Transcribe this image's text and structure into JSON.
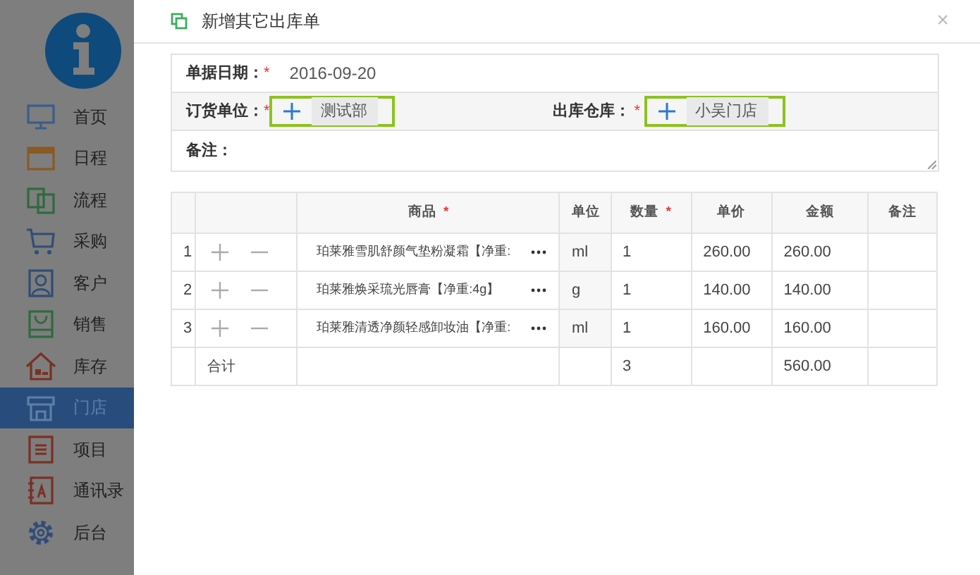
{
  "sidebar": {
    "items": [
      {
        "label": "首页",
        "selected": false
      },
      {
        "label": "日程",
        "selected": false
      },
      {
        "label": "流程",
        "selected": false
      },
      {
        "label": "采购",
        "selected": false
      },
      {
        "label": "客户",
        "selected": false
      },
      {
        "label": "销售",
        "selected": false
      },
      {
        "label": "库存",
        "selected": false
      },
      {
        "label": "门店",
        "selected": true
      },
      {
        "label": "项目",
        "selected": false
      },
      {
        "label": "通讯录",
        "selected": false
      },
      {
        "label": "后台",
        "selected": false
      }
    ]
  },
  "dialog": {
    "title": "新增其它出库单",
    "close": "×",
    "form": {
      "date": {
        "label": "单据日期：",
        "mark": "*",
        "value": "2016-09-20"
      },
      "customer": {
        "label": "订货单位：",
        "mark": "*",
        "value": "测试部",
        "highlighted": true
      },
      "warehouse": {
        "label": "出库仓库：",
        "mark": "*",
        "value": "小吴门店",
        "highlighted": true
      },
      "note": {
        "label": "备注："
      }
    },
    "table": {
      "columns": [
        {
          "label": "商品",
          "mark": "*"
        },
        {
          "label": "单位"
        },
        {
          "label": "数量",
          "mark": "*"
        },
        {
          "label": "单价"
        },
        {
          "label": "金额"
        },
        {
          "label": "备注"
        }
      ],
      "rows": [
        {
          "index": "1",
          "product": "珀莱雅雪肌舒颜气垫粉凝霜【净重:",
          "unit": "ml",
          "qty": "1",
          "price": "260.00",
          "amount": "260.00"
        },
        {
          "index": "2",
          "product": "珀莱雅焕采琉光唇膏【净重:4g】",
          "unit": "g",
          "qty": "1",
          "price": "140.00",
          "amount": "140.00"
        },
        {
          "index": "3",
          "product": "珀莱雅清透净颜轻感卸妆油【净重:",
          "unit": "ml",
          "qty": "1",
          "price": "160.00",
          "amount": "160.00"
        }
      ],
      "total": {
        "label": "合计",
        "qty": "3",
        "amount": "560.00"
      }
    }
  }
}
